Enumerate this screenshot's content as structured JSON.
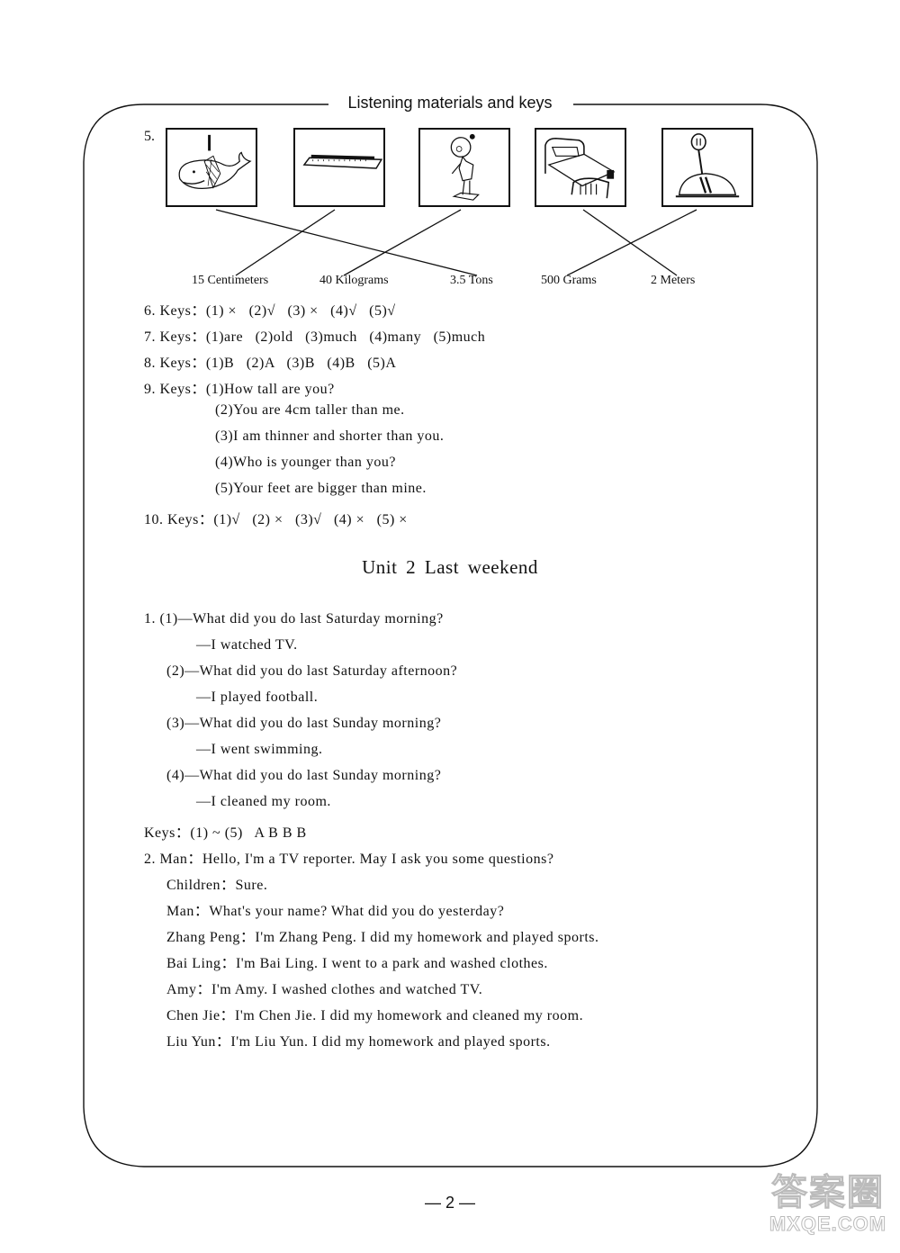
{
  "header": {
    "title": "Listening materials and keys"
  },
  "question5": {
    "number": "5.",
    "pictures": [
      {
        "name": "whale-picture"
      },
      {
        "name": "ruler-picture"
      },
      {
        "name": "girl-on-scale-picture"
      },
      {
        "name": "bed-picture"
      },
      {
        "name": "scale-picture"
      }
    ],
    "labels": [
      "15 Centimeters",
      "40 Kilograms",
      "3.5 Tons",
      "500 Grams",
      "2 Meters"
    ],
    "matches": [
      {
        "picture": 1,
        "label": 3
      },
      {
        "picture": 2,
        "label": 1
      },
      {
        "picture": 3,
        "label": 2
      },
      {
        "picture": 4,
        "label": 5
      },
      {
        "picture": 5,
        "label": 4
      }
    ]
  },
  "answers": [
    "6. Keys：(1) ×   (2)√   (3) ×   (4)√   (5)√",
    "7. Keys：(1)are   (2)old   (3)much   (4)many   (5)much",
    "8. Keys：(1)B   (2)A   (3)B   (4)B   (5)A",
    "9. Keys：(1)How tall are you?",
    "(2)You are 4cm taller than me.",
    "(3)I am thinner and shorter than you.",
    "(4)Who is younger than you?",
    "(5)Your feet are bigger than mine.",
    "10. Keys：(1)√   (2) ×   (3)√   (4) ×   (5) ×"
  ],
  "unit": {
    "title": "Unit 2    Last weekend"
  },
  "unit2_q1": [
    "1. (1)—What did you do last Saturday morning?",
    "—I watched TV.",
    "(2)—What did you do last Saturday afternoon?",
    "—I played football.",
    "(3)—What did you do last Sunday morning?",
    "—I went swimming.",
    "(4)—What did you do last Sunday morning?",
    "—I cleaned my room.",
    "Keys：(1) ~ (5)   A B B B"
  ],
  "unit2_q2": [
    "2. Man：Hello, I'm a TV reporter. May I ask you some questions?",
    "Children：Sure.",
    "Man：What's your name? What did you do yesterday?",
    "Zhang Peng：I'm Zhang Peng. I did my homework and played sports.",
    "Bai Ling：I'm Bai Ling. I went to a park and washed clothes.",
    "Amy：I'm Amy. I washed clothes and watched TV.",
    "Chen Jie：I'm Chen Jie. I did my homework and cleaned my room.",
    "Liu Yun：I'm Liu Yun. I did my homework and played sports."
  ],
  "footer": {
    "page_number": "— 2 —"
  },
  "watermark": {
    "line1": "答案圈",
    "line2": "MXQE.COM"
  }
}
